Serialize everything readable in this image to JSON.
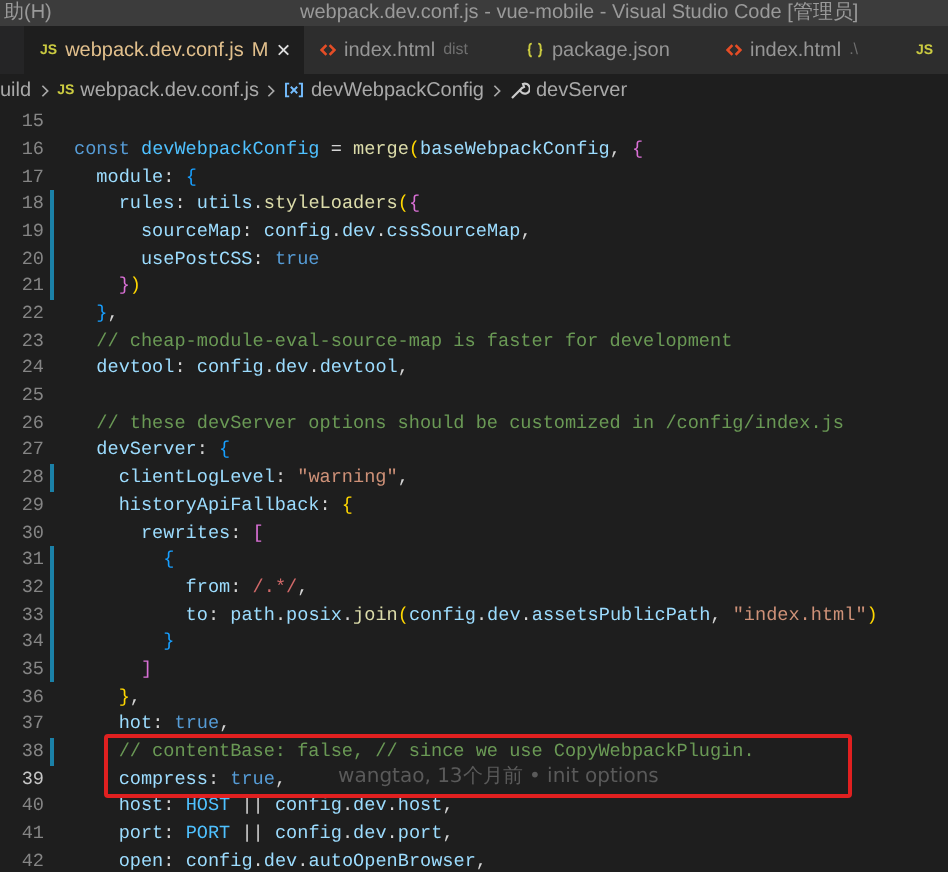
{
  "title_bar": {
    "menu_fragment": "助(H)",
    "title": "webpack.dev.conf.js - vue-mobile - Visual Studio Code [管理员]"
  },
  "tabs": [
    {
      "kind": "js",
      "icon_label": "JS",
      "label": "webpack.dev.conf.js",
      "badge": "M",
      "close": "×",
      "selected": true
    },
    {
      "kind": "html",
      "label": "index.html",
      "description": "dist",
      "selected": false
    },
    {
      "kind": "json",
      "label": "package.json",
      "selected": false
    },
    {
      "kind": "html",
      "label": "index.html",
      "description": ".\\",
      "selected": false
    },
    {
      "kind": "js",
      "icon_label": "JS",
      "selected": false
    }
  ],
  "breadcrumbs": [
    {
      "kind": "folder",
      "label": "uild"
    },
    {
      "kind": "js",
      "icon_label": "JS",
      "label": "webpack.dev.conf.js"
    },
    {
      "kind": "variable",
      "label": "devWebpackConfig"
    },
    {
      "kind": "property",
      "label": "devServer"
    }
  ],
  "editor": {
    "lines": [
      {
        "number": "15",
        "modified": false,
        "current": false,
        "boxed": false
      },
      {
        "number": "16",
        "modified": false,
        "current": false,
        "boxed": false,
        "tokens": [
          {
            "kind": "keyword",
            "text": "const"
          },
          {
            "kind": "constant",
            "text": " devWebpackConfig"
          },
          {
            "kind": "punct",
            "text": " = "
          },
          {
            "kind": "function",
            "text": "merge"
          },
          {
            "kind": "bracket1",
            "text": "("
          },
          {
            "kind": "variable",
            "text": "baseWebpackConfig"
          },
          {
            "kind": "punct",
            "text": ", "
          },
          {
            "kind": "bracket2",
            "text": "{"
          }
        ]
      },
      {
        "number": "17",
        "modified": false,
        "current": false,
        "boxed": false,
        "tokens": [
          {
            "kind": "variable",
            "text": "  module"
          },
          {
            "kind": "punct",
            "text": ": "
          },
          {
            "kind": "bracket3",
            "text": "{"
          }
        ]
      },
      {
        "number": "18",
        "modified": true,
        "current": false,
        "boxed": false,
        "tokens": [
          {
            "kind": "variable",
            "text": "    rules"
          },
          {
            "kind": "punct",
            "text": ": "
          },
          {
            "kind": "variable",
            "text": "utils"
          },
          {
            "kind": "punct",
            "text": "."
          },
          {
            "kind": "function",
            "text": "styleLoaders"
          },
          {
            "kind": "bracket1",
            "text": "("
          },
          {
            "kind": "bracket2",
            "text": "{"
          }
        ]
      },
      {
        "number": "19",
        "modified": true,
        "current": false,
        "boxed": false,
        "tokens": [
          {
            "kind": "variable",
            "text": "      sourceMap"
          },
          {
            "kind": "punct",
            "text": ": "
          },
          {
            "kind": "variable",
            "text": "config"
          },
          {
            "kind": "punct",
            "text": "."
          },
          {
            "kind": "variable",
            "text": "dev"
          },
          {
            "kind": "punct",
            "text": "."
          },
          {
            "kind": "variable",
            "text": "cssSourceMap"
          },
          {
            "kind": "punct",
            "text": ","
          }
        ]
      },
      {
        "number": "20",
        "modified": true,
        "current": false,
        "boxed": false,
        "tokens": [
          {
            "kind": "variable",
            "text": "      usePostCSS"
          },
          {
            "kind": "punct",
            "text": ": "
          },
          {
            "kind": "keyword",
            "text": "true"
          }
        ]
      },
      {
        "number": "21",
        "modified": true,
        "current": false,
        "boxed": false,
        "tokens": [
          {
            "kind": "bracket2",
            "text": "    }"
          },
          {
            "kind": "bracket1",
            "text": ")"
          }
        ]
      },
      {
        "number": "22",
        "modified": false,
        "current": false,
        "boxed": false,
        "tokens": [
          {
            "kind": "bracket3",
            "text": "  }"
          },
          {
            "kind": "punct",
            "text": ","
          }
        ]
      },
      {
        "number": "23",
        "modified": false,
        "current": false,
        "boxed": false,
        "tokens": [
          {
            "kind": "comment",
            "text": "  // cheap-module-eval-source-map is faster for development"
          }
        ]
      },
      {
        "number": "24",
        "modified": false,
        "current": false,
        "boxed": false,
        "tokens": [
          {
            "kind": "variable",
            "text": "  devtool"
          },
          {
            "kind": "punct",
            "text": ": "
          },
          {
            "kind": "variable",
            "text": "config"
          },
          {
            "kind": "punct",
            "text": "."
          },
          {
            "kind": "variable",
            "text": "dev"
          },
          {
            "kind": "punct",
            "text": "."
          },
          {
            "kind": "variable",
            "text": "devtool"
          },
          {
            "kind": "punct",
            "text": ","
          }
        ]
      },
      {
        "number": "25",
        "modified": false,
        "current": false,
        "boxed": false
      },
      {
        "number": "26",
        "modified": false,
        "current": false,
        "boxed": false,
        "tokens": [
          {
            "kind": "comment",
            "text": "  // these devServer options should be customized in /config/index.js"
          }
        ]
      },
      {
        "number": "27",
        "modified": false,
        "current": false,
        "boxed": false,
        "tokens": [
          {
            "kind": "variable",
            "text": "  devServer"
          },
          {
            "kind": "punct",
            "text": ": "
          },
          {
            "kind": "bracket3",
            "text": "{"
          }
        ]
      },
      {
        "number": "28",
        "modified": true,
        "current": false,
        "boxed": false,
        "tokens": [
          {
            "kind": "variable",
            "text": "    clientLogLevel"
          },
          {
            "kind": "punct",
            "text": ": "
          },
          {
            "kind": "string",
            "text": "\"warning\""
          },
          {
            "kind": "punct",
            "text": ","
          }
        ]
      },
      {
        "number": "29",
        "modified": false,
        "current": false,
        "boxed": false,
        "tokens": [
          {
            "kind": "variable",
            "text": "    historyApiFallback"
          },
          {
            "kind": "punct",
            "text": ": "
          },
          {
            "kind": "bracket1",
            "text": "{"
          }
        ]
      },
      {
        "number": "30",
        "modified": false,
        "current": false,
        "boxed": false,
        "tokens": [
          {
            "kind": "variable",
            "text": "      rewrites"
          },
          {
            "kind": "punct",
            "text": ": "
          },
          {
            "kind": "bracket2",
            "text": "["
          }
        ]
      },
      {
        "number": "31",
        "modified": true,
        "current": false,
        "boxed": false,
        "tokens": [
          {
            "kind": "bracket3",
            "text": "        {"
          }
        ]
      },
      {
        "number": "32",
        "modified": true,
        "current": false,
        "boxed": false,
        "tokens": [
          {
            "kind": "variable",
            "text": "          from"
          },
          {
            "kind": "punct",
            "text": ": "
          },
          {
            "kind": "regex",
            "text": "/.*/"
          },
          {
            "kind": "punct",
            "text": ","
          }
        ]
      },
      {
        "number": "33",
        "modified": true,
        "current": false,
        "boxed": false,
        "tokens": [
          {
            "kind": "variable",
            "text": "          to"
          },
          {
            "kind": "punct",
            "text": ": "
          },
          {
            "kind": "variable",
            "text": "path"
          },
          {
            "kind": "punct",
            "text": "."
          },
          {
            "kind": "variable",
            "text": "posix"
          },
          {
            "kind": "punct",
            "text": "."
          },
          {
            "kind": "function",
            "text": "join"
          },
          {
            "kind": "bracket1",
            "text": "("
          },
          {
            "kind": "variable",
            "text": "config"
          },
          {
            "kind": "punct",
            "text": "."
          },
          {
            "kind": "variable",
            "text": "dev"
          },
          {
            "kind": "punct",
            "text": "."
          },
          {
            "kind": "variable",
            "text": "assetsPublicPath"
          },
          {
            "kind": "punct",
            "text": ", "
          },
          {
            "kind": "string",
            "text": "\"index.html\""
          },
          {
            "kind": "bracket1",
            "text": ")"
          }
        ]
      },
      {
        "number": "34",
        "modified": true,
        "current": false,
        "boxed": false,
        "tokens": [
          {
            "kind": "bracket3",
            "text": "        }"
          }
        ]
      },
      {
        "number": "35",
        "modified": true,
        "current": false,
        "boxed": false,
        "tokens": [
          {
            "kind": "bracket2",
            "text": "      ]"
          }
        ]
      },
      {
        "number": "36",
        "modified": false,
        "current": false,
        "boxed": false,
        "tokens": [
          {
            "kind": "bracket1",
            "text": "    }"
          },
          {
            "kind": "punct",
            "text": ","
          }
        ]
      },
      {
        "number": "37",
        "modified": false,
        "current": false,
        "boxed": false,
        "tokens": [
          {
            "kind": "variable",
            "text": "    hot"
          },
          {
            "kind": "punct",
            "text": ": "
          },
          {
            "kind": "keyword",
            "text": "true"
          },
          {
            "kind": "punct",
            "text": ","
          }
        ]
      },
      {
        "number": "38",
        "modified": true,
        "current": false,
        "boxed": true,
        "tokens": [
          {
            "kind": "comment",
            "text": "    // contentBase: false, // since we use CopyWebpackPlugin."
          }
        ]
      },
      {
        "number": "39",
        "modified": false,
        "current": true,
        "boxed": true,
        "blame": "wangtao, 13个月前 • init options",
        "tokens": [
          {
            "kind": "variable",
            "text": "    compress"
          },
          {
            "kind": "punct",
            "text": ": "
          },
          {
            "kind": "keyword",
            "text": "true"
          },
          {
            "kind": "punct",
            "text": ","
          }
        ]
      },
      {
        "number": "40",
        "modified": false,
        "current": false,
        "boxed": false,
        "tokens": [
          {
            "kind": "variable",
            "text": "    host"
          },
          {
            "kind": "punct",
            "text": ": "
          },
          {
            "kind": "constant",
            "text": "HOST"
          },
          {
            "kind": "punct",
            "text": " || "
          },
          {
            "kind": "variable",
            "text": "config"
          },
          {
            "kind": "punct",
            "text": "."
          },
          {
            "kind": "variable",
            "text": "dev"
          },
          {
            "kind": "punct",
            "text": "."
          },
          {
            "kind": "variable",
            "text": "host"
          },
          {
            "kind": "punct",
            "text": ","
          }
        ]
      },
      {
        "number": "41",
        "modified": false,
        "current": false,
        "boxed": false,
        "tokens": [
          {
            "kind": "variable",
            "text": "    port"
          },
          {
            "kind": "punct",
            "text": ": "
          },
          {
            "kind": "constant",
            "text": "PORT"
          },
          {
            "kind": "punct",
            "text": " || "
          },
          {
            "kind": "variable",
            "text": "config"
          },
          {
            "kind": "punct",
            "text": "."
          },
          {
            "kind": "variable",
            "text": "dev"
          },
          {
            "kind": "punct",
            "text": "."
          },
          {
            "kind": "variable",
            "text": "port"
          },
          {
            "kind": "punct",
            "text": ","
          }
        ]
      },
      {
        "number": "42",
        "modified": false,
        "current": false,
        "boxed": false,
        "tokens": [
          {
            "kind": "variable",
            "text": "    open"
          },
          {
            "kind": "punct",
            "text": ": "
          },
          {
            "kind": "variable",
            "text": "config"
          },
          {
            "kind": "punct",
            "text": "."
          },
          {
            "kind": "variable",
            "text": "dev"
          },
          {
            "kind": "punct",
            "text": "."
          },
          {
            "kind": "variable",
            "text": "autoOpenBrowser"
          },
          {
            "kind": "punct",
            "text": ","
          }
        ]
      }
    ]
  }
}
